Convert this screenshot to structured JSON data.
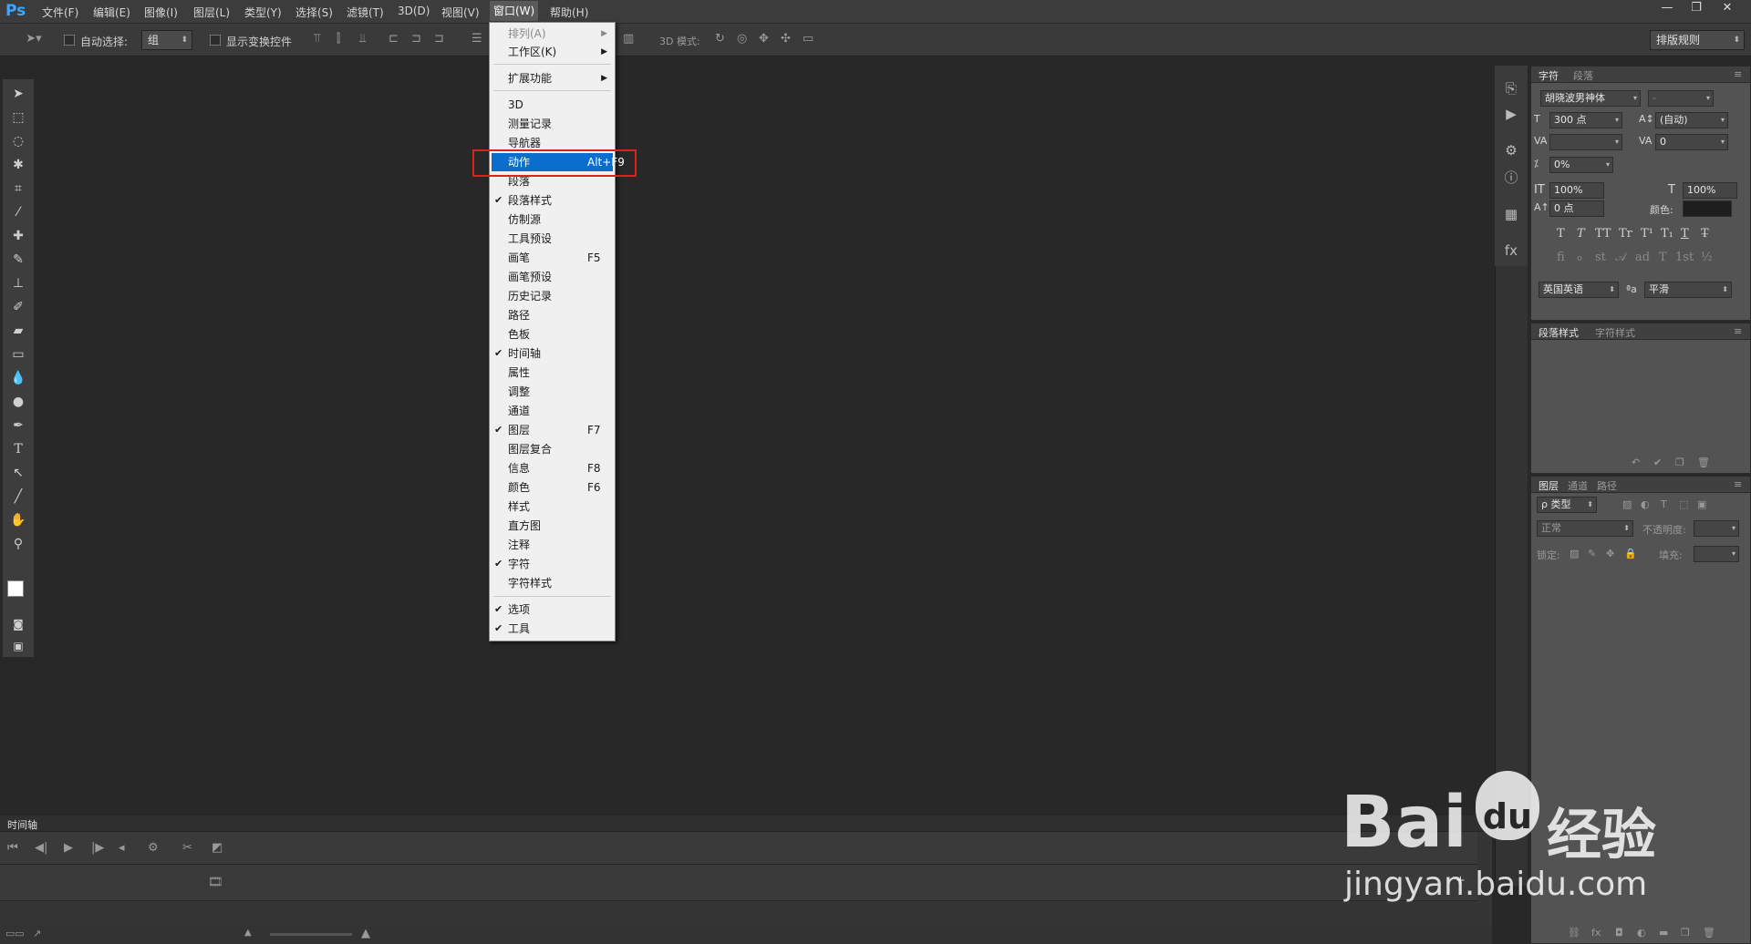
{
  "app": {
    "logo": "Ps"
  },
  "menubar": {
    "items": [
      "文件(F)",
      "编辑(E)",
      "图像(I)",
      "图层(L)",
      "类型(Y)",
      "选择(S)",
      "滤镜(T)",
      "3D(D)",
      "视图(V)",
      "窗口(W)",
      "帮助(H)"
    ],
    "active": "窗口(W)"
  },
  "window_controls": {
    "minimize": "—",
    "restore": "❐",
    "close": "✕"
  },
  "options": {
    "auto_select_label": "自动选择:",
    "auto_select_value": "组",
    "show_transform_label": "显示变换控件",
    "mode_3d_label": "3D 模式:",
    "workspace": "排版规则"
  },
  "window_menu": {
    "items": [
      {
        "label": "排列(A)",
        "submenu": true,
        "disabled": true
      },
      {
        "label": "工作区(K)",
        "submenu": true
      },
      {
        "label": "扩展功能",
        "submenu": true
      },
      {
        "label": "3D"
      },
      {
        "label": "测量记录"
      },
      {
        "label": "导航器"
      },
      {
        "label": "动作",
        "shortcut": "Alt+F9",
        "highlighted": true
      },
      {
        "label": "段落"
      },
      {
        "label": "段落样式",
        "checked": true
      },
      {
        "label": "仿制源"
      },
      {
        "label": "工具预设"
      },
      {
        "label": "画笔",
        "shortcut": "F5"
      },
      {
        "label": "画笔预设"
      },
      {
        "label": "历史记录"
      },
      {
        "label": "路径"
      },
      {
        "label": "色板"
      },
      {
        "label": "时间轴",
        "checked": true
      },
      {
        "label": "属性"
      },
      {
        "label": "调整"
      },
      {
        "label": "通道"
      },
      {
        "label": "图层",
        "shortcut": "F7",
        "checked": true
      },
      {
        "label": "图层复合"
      },
      {
        "label": "信息",
        "shortcut": "F8"
      },
      {
        "label": "颜色",
        "shortcut": "F6"
      },
      {
        "label": "样式"
      },
      {
        "label": "直方图"
      },
      {
        "label": "注释"
      },
      {
        "label": "字符",
        "checked": true
      },
      {
        "label": "字符样式"
      },
      {
        "label": "选项",
        "checked": true
      },
      {
        "label": "工具",
        "checked": true
      }
    ]
  },
  "character_panel": {
    "tabs": [
      "字符",
      "段落"
    ],
    "font_family": "胡晓波男神体",
    "font_style": "-",
    "font_size": "300 点",
    "leading": "(自动)",
    "kerning": "",
    "tracking": "0",
    "tsume": "0%",
    "vertical_scale": "100%",
    "horizontal_scale": "100%",
    "baseline_shift": "0 点",
    "color_label": "颜色:",
    "color_value": "#1e1e1e",
    "style_buttons": [
      "T",
      "T",
      "TT",
      "Tr",
      "T¹",
      "T₁",
      "T",
      "T̶"
    ],
    "opentype_buttons": [
      "fi",
      "ℴ",
      "st",
      "𝒜",
      "ad",
      "T",
      "1st",
      "½"
    ],
    "language": "英国英语",
    "aa_label": "ªa",
    "antialias": "平滑"
  },
  "paragraph_styles_panel": {
    "tabs": [
      "段落样式",
      "字符样式"
    ]
  },
  "layers_panel": {
    "tabs": [
      "图层",
      "通道",
      "路径"
    ],
    "filter": "ρ 类型",
    "blend_mode": "正常",
    "opacity_label": "不透明度:",
    "lock_label": "锁定:",
    "fill_label": "填充:"
  },
  "timeline": {
    "tab": "时间轴"
  },
  "watermark": {
    "brand": "Bai",
    "paw": "du",
    "cn": "经验",
    "url": "jingyan.baidu.com"
  },
  "colors": {
    "highlight": "#0b6dcc",
    "callout": "#e02020",
    "ps_blue": "#3ea6ff"
  }
}
